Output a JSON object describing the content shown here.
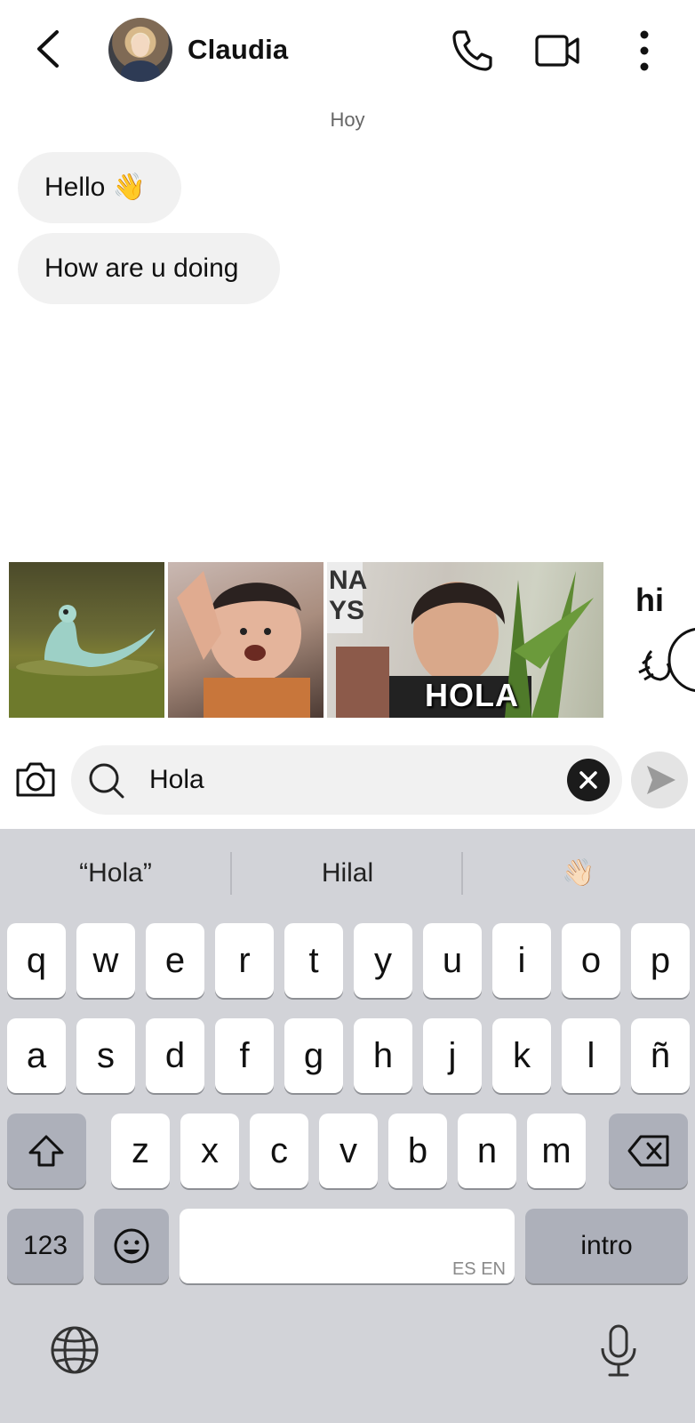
{
  "header": {
    "contact_name": "Claudia",
    "icons": [
      "back-arrow-icon",
      "avatar",
      "phone-icon",
      "video-icon",
      "more-vertical-icon"
    ]
  },
  "chat": {
    "day_label": "Hoy",
    "messages": [
      {
        "text": "Hello 👋"
      },
      {
        "text": "How are u doing"
      }
    ]
  },
  "gifs": {
    "items": [
      {
        "caption": ""
      },
      {
        "caption": ""
      },
      {
        "caption": "HOLA"
      },
      {
        "caption": "hi"
      }
    ]
  },
  "composer": {
    "search_value": "Hola"
  },
  "keyboard": {
    "suggestions": [
      "“Hola”",
      "Hilal",
      "👋🏻"
    ],
    "row1": [
      "q",
      "w",
      "e",
      "r",
      "t",
      "y",
      "u",
      "i",
      "o",
      "p"
    ],
    "row2": [
      "a",
      "s",
      "d",
      "f",
      "g",
      "h",
      "j",
      "k",
      "l",
      "ñ"
    ],
    "row3": [
      "z",
      "x",
      "c",
      "v",
      "b",
      "n",
      "m"
    ],
    "numbers_label": "123",
    "emoji_label": "☺",
    "space_lang_hint": "ES EN",
    "return_label": "intro"
  }
}
